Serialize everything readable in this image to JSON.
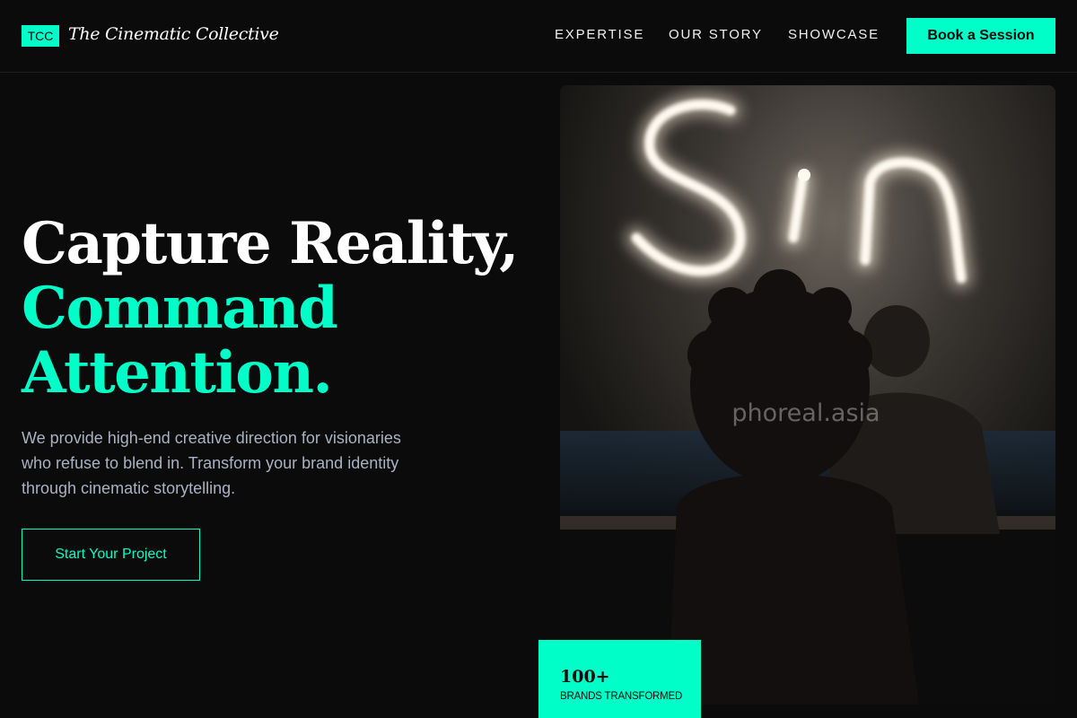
{
  "brand": {
    "badge": "TCC",
    "name": "The Cinematic Collective"
  },
  "nav": {
    "expertise": "EXPERTISE",
    "our_story": "OUR STORY",
    "showcase": "SHOWCASE",
    "book_label": "Book a Session"
  },
  "hero": {
    "headline_line1": "Capture Reality,",
    "headline_line2": "Command",
    "headline_line3": "Attention.",
    "description": "We provide high-end creative direction for visionaries who refuse to blend in. Transform your brand identity through cinematic storytelling.",
    "cta_label": "Start Your Project"
  },
  "image": {
    "watermark": "phoreal.asia",
    "sign_text": "Sin"
  },
  "stat": {
    "number": "100+",
    "label": "BRANDS TRANSFORMED"
  },
  "colors": {
    "accent": "#00ffc8",
    "background": "#0b0b0b",
    "body_text": "#aab1c2"
  }
}
